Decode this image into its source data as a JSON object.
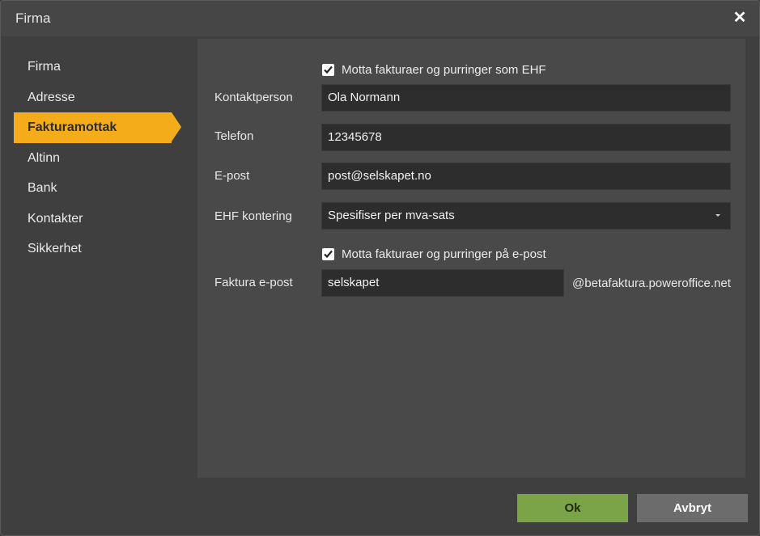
{
  "dialog": {
    "title": "Firma",
    "close_icon": "close-icon"
  },
  "sidebar": {
    "items": [
      {
        "label": "Firma",
        "active": false
      },
      {
        "label": "Adresse",
        "active": false
      },
      {
        "label": "Fakturamottak",
        "active": true
      },
      {
        "label": "Altinn",
        "active": false
      },
      {
        "label": "Bank",
        "active": false
      },
      {
        "label": "Kontakter",
        "active": false
      },
      {
        "label": "Sikkerhet",
        "active": false
      }
    ]
  },
  "form": {
    "ehf_checkbox": {
      "label": "Motta fakturaer og purringer som EHF",
      "checked": true
    },
    "contact": {
      "label": "Kontaktperson",
      "value": "Ola Normann"
    },
    "phone": {
      "label": "Telefon",
      "value": "12345678"
    },
    "email": {
      "label": "E-post",
      "value": "post@selskapet.no"
    },
    "ehf_posting": {
      "label": "EHF kontering",
      "value": "Spesifiser per mva-sats"
    },
    "email_checkbox": {
      "label": "Motta fakturaer og purringer på e-post",
      "checked": true
    },
    "invoice_email": {
      "label": "Faktura e-post",
      "value": "selskapet",
      "suffix": "@betafaktura.poweroffice.net"
    }
  },
  "buttons": {
    "ok": "Ok",
    "cancel": "Avbryt"
  },
  "colors": {
    "accent": "#f5ac1a",
    "ok_button": "#7ba347",
    "cancel_button": "#6c6c6c"
  }
}
